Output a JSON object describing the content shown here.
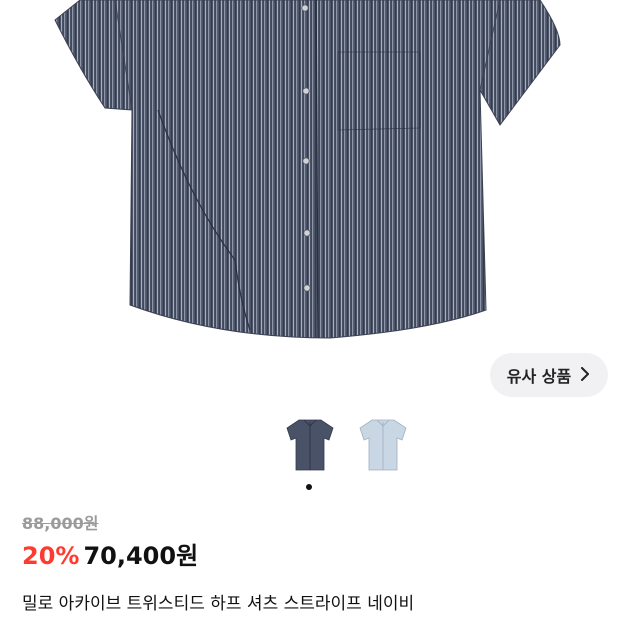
{
  "product": {
    "title": "밀로 아카이브 트위스티드 하프 셔츠 스트라이프 네이비",
    "original_price": "88,000원",
    "discount_rate": "20%",
    "sale_price": "70,400원"
  },
  "similar_products": {
    "label": "유사 상품",
    "icon": "chevron-right-icon"
  },
  "thumbnails": [
    {
      "name": "navy",
      "color": "#4a5268",
      "selected": true
    },
    {
      "name": "sky",
      "color": "#c9d6e3",
      "selected": false
    }
  ],
  "colors": {
    "discount": "#ff3b30",
    "strikethrough_text": "#9b9b9b",
    "pill_bg": "#f1f1f3"
  }
}
